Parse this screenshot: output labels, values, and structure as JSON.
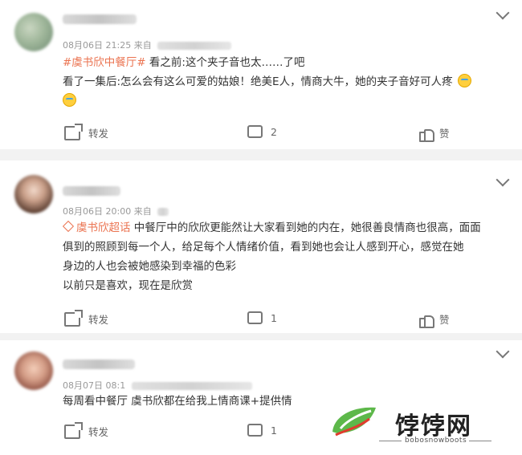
{
  "posts": [
    {
      "meta_date": "08月06日 21:25",
      "meta_source": "来自",
      "hashtag": "#虞书欣中餐厅#",
      "line1": "看之前:这个夹子音也太……了吧",
      "line2": "看了一集后:怎么会有这么可爱的姑娘！绝美E人，情商大牛，她的夹子音好可人疼",
      "share_label": "转发",
      "comment_count": "2",
      "like_label": "赞"
    },
    {
      "meta_date": "08月06日 20:00",
      "meta_source": "来自",
      "super_topic": "虞书欣超话",
      "line1": "中餐厅中的欣欣更能然让大家看到她的内在，她很善良情商也很高，面面",
      "line2": "俱到的照顾到每一个人，给足每个人情绪价值，看到她也会让人感到开心，感觉在她",
      "line3": "身边的人也会被她感染到幸福的色彩",
      "line4": "以前只是喜欢，现在是欣赏",
      "share_label": "转发",
      "comment_count": "1",
      "like_label": "赞"
    },
    {
      "meta_date": "08月07日 08:1",
      "line1": "每周看中餐厅 虞书欣都在给我上情商课+提供情",
      "share_label": "转发",
      "comment_count": "1"
    }
  ],
  "watermark": {
    "name": "饽饽网",
    "domain": "bobosnowboots"
  }
}
